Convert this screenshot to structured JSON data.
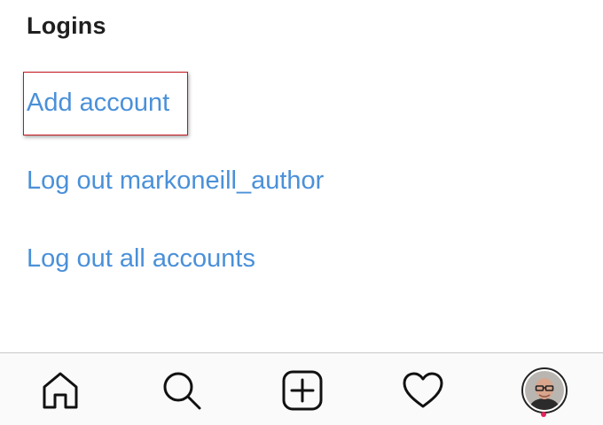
{
  "settings": {
    "section_title": "Logins",
    "options": [
      {
        "label": "Add account"
      },
      {
        "label": "Log out markoneill_author"
      },
      {
        "label": "Log out all accounts"
      }
    ],
    "highlighted_option": "Add account"
  },
  "tab_bar": {
    "tabs": [
      {
        "icon": "home-icon"
      },
      {
        "icon": "search-icon"
      },
      {
        "icon": "new-post-icon"
      },
      {
        "icon": "heart-icon"
      },
      {
        "icon": "profile-avatar"
      }
    ]
  },
  "colors": {
    "link": "#4a90d9",
    "title": "#1f1f1f",
    "highlight_border": "#c4161c",
    "notification_dot": "#e0245e",
    "tab_bar_bg": "#fafafa"
  }
}
